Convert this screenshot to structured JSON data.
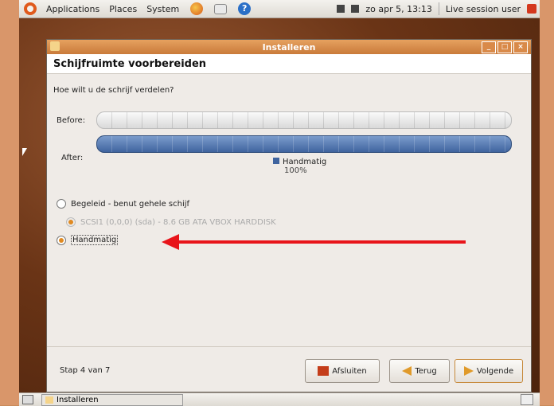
{
  "top_panel": {
    "menus": [
      "Applications",
      "Places",
      "System"
    ],
    "datetime": "zo apr  5, 13:13",
    "session_user": "Live session user"
  },
  "window": {
    "title": "Installeren",
    "page_title": "Schijfruimte voorbereiden",
    "question": "Hoe wilt u de schrijf verdelen?",
    "before_label": "Before:",
    "after_label": "After:",
    "legend": {
      "name": "Handmatig",
      "percent": "100%"
    },
    "options": [
      {
        "label": "Begeleid - benut gehele schijf",
        "selected": false,
        "disabled": false
      },
      {
        "label": "SCSI1 (0,0,0) (sda) - 8.6 GB ATA VBOX HARDDISK",
        "selected": true,
        "disabled": true
      },
      {
        "label": "Handmatig",
        "selected": true,
        "disabled": false
      }
    ],
    "step_text": "Stap 4 van 7",
    "buttons": {
      "quit": "Afsluiten",
      "back": "Terug",
      "next": "Volgende"
    }
  },
  "bottom_panel": {
    "task": "Installeren"
  },
  "colors": {
    "accent": "#e08a22",
    "bar_after": "#3f649f",
    "annotation_arrow": "#e8141a",
    "titlebar": "#d98a49"
  }
}
